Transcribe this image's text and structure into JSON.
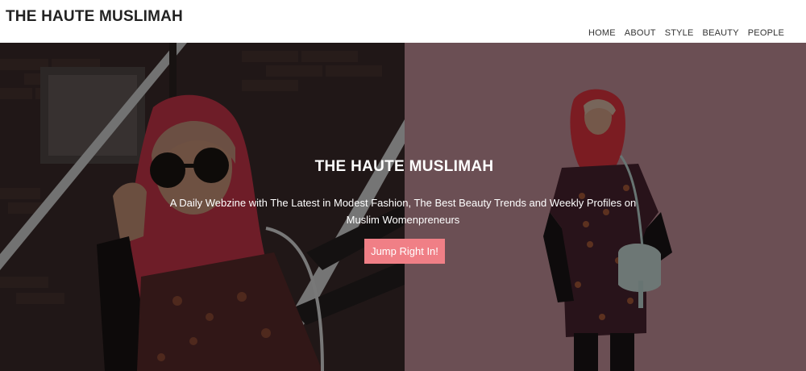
{
  "header": {
    "site_title": "THE HAUTE MUSLIMAH",
    "nav": [
      "HOME",
      "ABOUT",
      "STYLE",
      "BEAUTY",
      "PEOPLE"
    ]
  },
  "hero": {
    "title": "THE HAUTE MUSLIMAH",
    "subtitle": "A Daily Webzine with The Latest in Modest Fashion, The Best Beauty Trends and Weekly Profiles on Muslim Womenpreneurs",
    "cta_label": "Jump Right In!"
  },
  "colors": {
    "accent": "#f07f86",
    "right_backdrop": "#b98591"
  }
}
